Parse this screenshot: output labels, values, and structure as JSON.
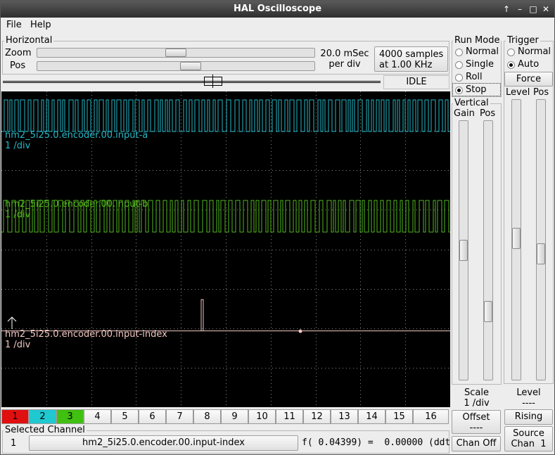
{
  "window": {
    "title": "HAL Oscilloscope"
  },
  "menu": {
    "file": "File",
    "help": "Help"
  },
  "horizontal": {
    "frame_label": "Horizontal",
    "zoom_label": "Zoom",
    "pos_label": "Pos",
    "time_per_div_line1": "20.0 mSec",
    "time_per_div_line2": "per div",
    "samples_line1": "4000 samples",
    "samples_line2": "at 1.00 KHz",
    "status": "IDLE"
  },
  "run_mode": {
    "frame_label": "Run Mode",
    "options": [
      "Normal",
      "Single",
      "Roll",
      "Stop"
    ],
    "selected": "Stop"
  },
  "trigger": {
    "frame_label": "Trigger",
    "options": [
      "Normal",
      "Auto"
    ],
    "selected": "Auto",
    "force_label": "Force",
    "level_label": "Level",
    "pos_label": "Pos",
    "level_title": "Level",
    "level_value": "----",
    "edge_button": "Rising",
    "source_line1": "Source",
    "source_line2": "Chan  1"
  },
  "vertical": {
    "frame_label": "Vertical",
    "gain_label": "Gain",
    "pos_label": "Pos",
    "scale_title": "Scale",
    "scale_value": "1 /div",
    "offset_line1": "Offset",
    "offset_line2": "----",
    "chan_off_button": "Chan Off"
  },
  "traces": [
    {
      "name": "hm2_5i25.0.encoder.00.input-a",
      "scale": "1 /div",
      "color": "#25b8c8"
    },
    {
      "name": "hm2_5i25.0.encoder.00.input-b",
      "scale": "1 /div",
      "color": "#52b81e"
    },
    {
      "name": "hm2_5i25.0.encoder.00.input-index",
      "scale": "1 /div",
      "color": "#f0c6c0"
    }
  ],
  "channel_buttons": [
    {
      "label": "1",
      "color": "#e01010"
    },
    {
      "label": "2",
      "color": "#20c8d0"
    },
    {
      "label": "3",
      "color": "#40c010"
    },
    {
      "label": "4",
      "color": ""
    },
    {
      "label": "5",
      "color": ""
    },
    {
      "label": "6",
      "color": ""
    },
    {
      "label": "7",
      "color": ""
    },
    {
      "label": "8",
      "color": ""
    },
    {
      "label": "9",
      "color": ""
    },
    {
      "label": "10",
      "color": ""
    },
    {
      "label": "11",
      "color": ""
    },
    {
      "label": "12",
      "color": ""
    },
    {
      "label": "13",
      "color": ""
    },
    {
      "label": "14",
      "color": ""
    },
    {
      "label": "15",
      "color": ""
    },
    {
      "label": "16",
      "color": ""
    }
  ],
  "selected_channel": {
    "frame_label": "Selected Channel",
    "number": "1",
    "name": "hm2_5i25.0.encoder.00.input-index",
    "readout": "f( 0.04399) =  0.00000 (ddt"
  },
  "icons": {
    "minimize": "arrow-up-icon",
    "restore": "restore-icon",
    "maximize": "maximize-icon",
    "close": "close-icon",
    "trigger_marker": "trigger-arrow-icon"
  }
}
